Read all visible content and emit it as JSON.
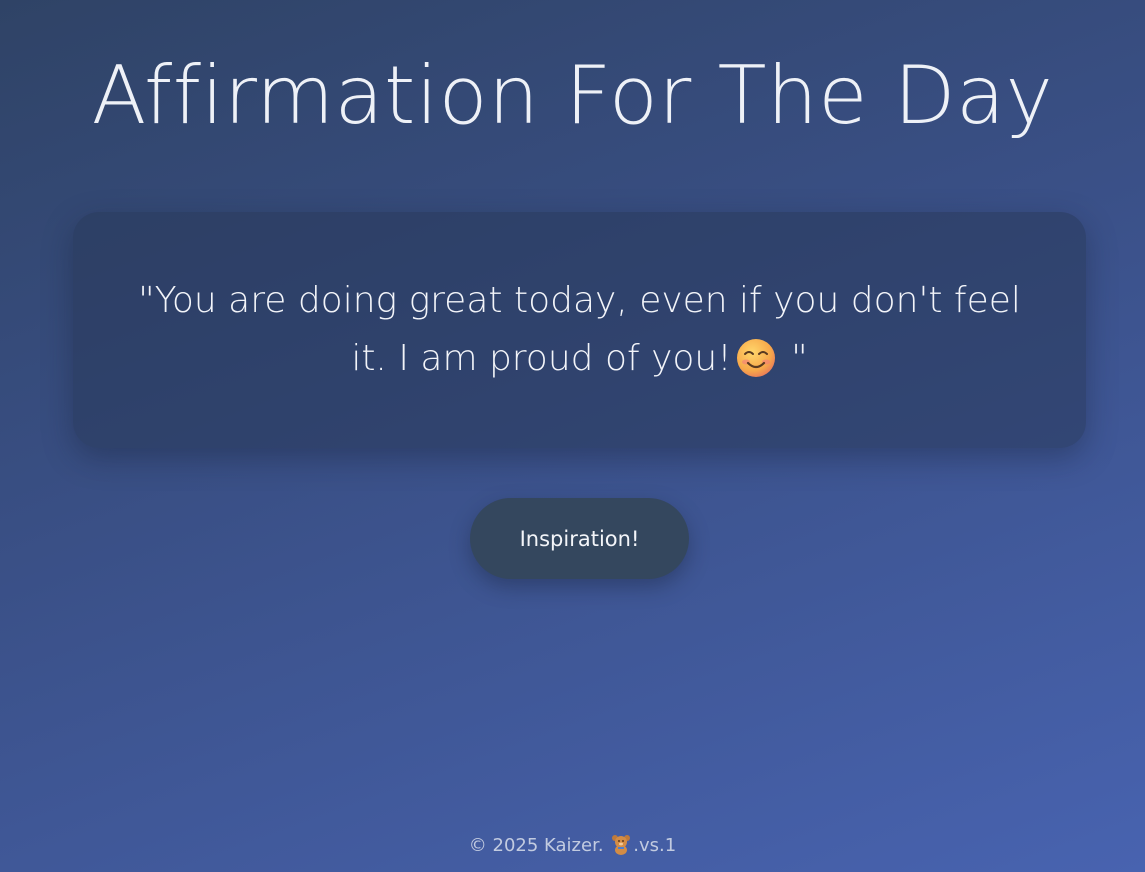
{
  "header": {
    "title": "Affirmation For The Day"
  },
  "affirmation": {
    "text_before_emoji": "\"You are doing great today, even if you don't feel it. I am proud of you!",
    "emoji_icon": "smiling-face-icon",
    "text_after_emoji": " \""
  },
  "actions": {
    "inspiration_label": "Inspiration!"
  },
  "footer": {
    "copyright": "© 2025 Kaizer.",
    "bear_icon": "teddy-bear-icon",
    "version": ".vs.1"
  },
  "colors": {
    "background_start": "#2f4366",
    "background_end": "#4863b0",
    "card_background": "#2b3a5a",
    "button_background": "#34475e",
    "text": "#eef1f7"
  }
}
